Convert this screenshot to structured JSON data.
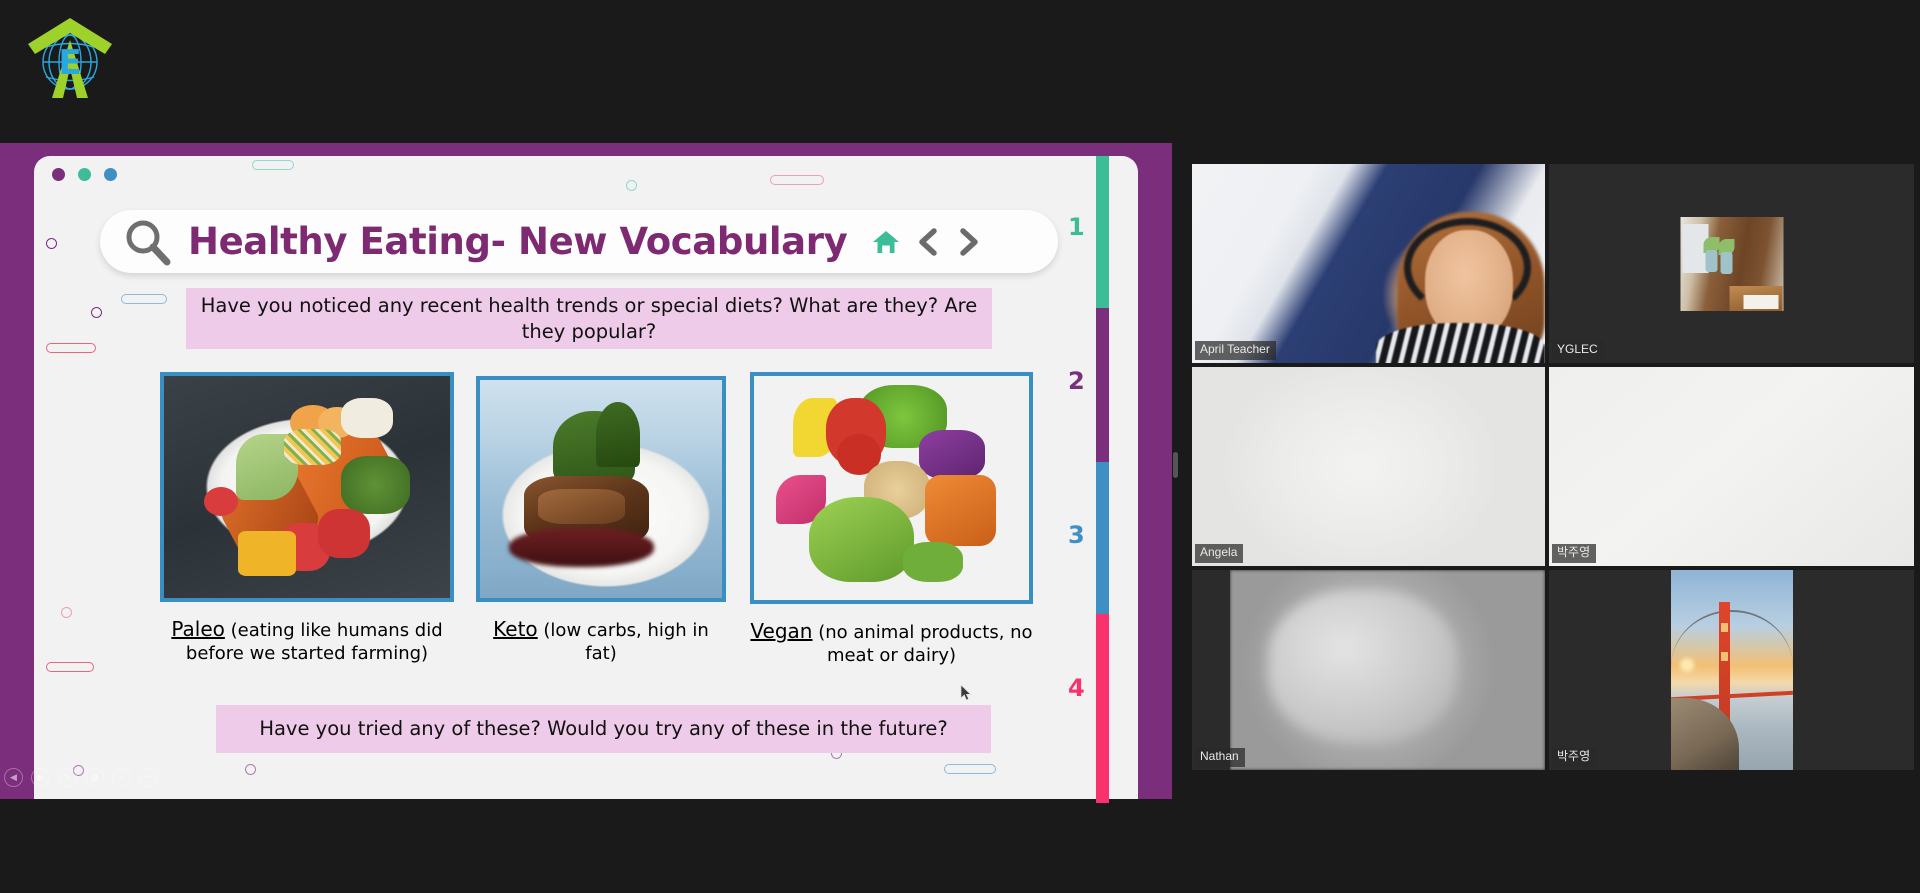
{
  "app": {
    "background_color": "#1a1a1a",
    "logo": {
      "icon": "globe-arrow-logo",
      "letter": "E"
    }
  },
  "share": {
    "frame_color": "#7b2e7b",
    "window_dots": [
      "#7b2e7b",
      "#3dbd97",
      "#3d8fc4"
    ],
    "slide": {
      "title": "Healthy Eating- New Vocabulary",
      "title_color": "#7d2a72",
      "search_icon": "search-icon",
      "nav": [
        {
          "icon": "home-icon",
          "color": "#3dbd97"
        },
        {
          "icon": "chevron-left-icon",
          "color": "#6b6b6b"
        },
        {
          "icon": "chevron-right-icon",
          "color": "#6b6b6b"
        }
      ],
      "prompt_top": "Have you noticed any recent health trends or special diets? What are they? Are they popular?",
      "prompt_bottom": "Have you tried any of these? Would you try any of these in the future?",
      "banner_color": "#eecbe8",
      "cards": [
        {
          "term": "Paleo",
          "definition": "(eating like humans did before we started farming)",
          "image_alt": "grilled-salmon-plate-photo"
        },
        {
          "term": "Keto",
          "definition": "(low carbs, high in fat)",
          "image_alt": "steak-broccolini-plate-photo"
        },
        {
          "term": "Vegan",
          "definition": "(no animal products, no meat or dairy)",
          "image_alt": "vegan-buddha-bowl-photo"
        }
      ],
      "rail": [
        {
          "number": "1",
          "color": "#3dbd97"
        },
        {
          "number": "2",
          "color": "#7b2e7b"
        },
        {
          "number": "3",
          "color": "#3d8fc4"
        },
        {
          "number": "4",
          "color": "#f9326e"
        }
      ],
      "controls": [
        {
          "icon": "previous-icon",
          "glyph": "◀"
        },
        {
          "icon": "play-icon",
          "glyph": "▶"
        },
        {
          "icon": "pen-icon",
          "glyph": "✎"
        },
        {
          "icon": "grid-icon",
          "glyph": "▦"
        },
        {
          "icon": "zoom-icon",
          "glyph": "⌕"
        },
        {
          "icon": "more-icon",
          "glyph": "•••"
        }
      ]
    }
  },
  "video_grid": {
    "active_border_color": "#d4e832",
    "tiles": [
      {
        "name": "April Teacher",
        "kind": "webcam",
        "active": false
      },
      {
        "name": "YGLEC",
        "kind": "photo-room",
        "active": false
      },
      {
        "name": "Angela",
        "kind": "whiteboard",
        "active": true
      },
      {
        "name": "박주영",
        "kind": "whiteboard",
        "active": true
      },
      {
        "name": "Nathan",
        "kind": "webcam-blur",
        "active": false
      },
      {
        "name": "박주영",
        "kind": "photo-bridge",
        "active": false
      }
    ]
  }
}
